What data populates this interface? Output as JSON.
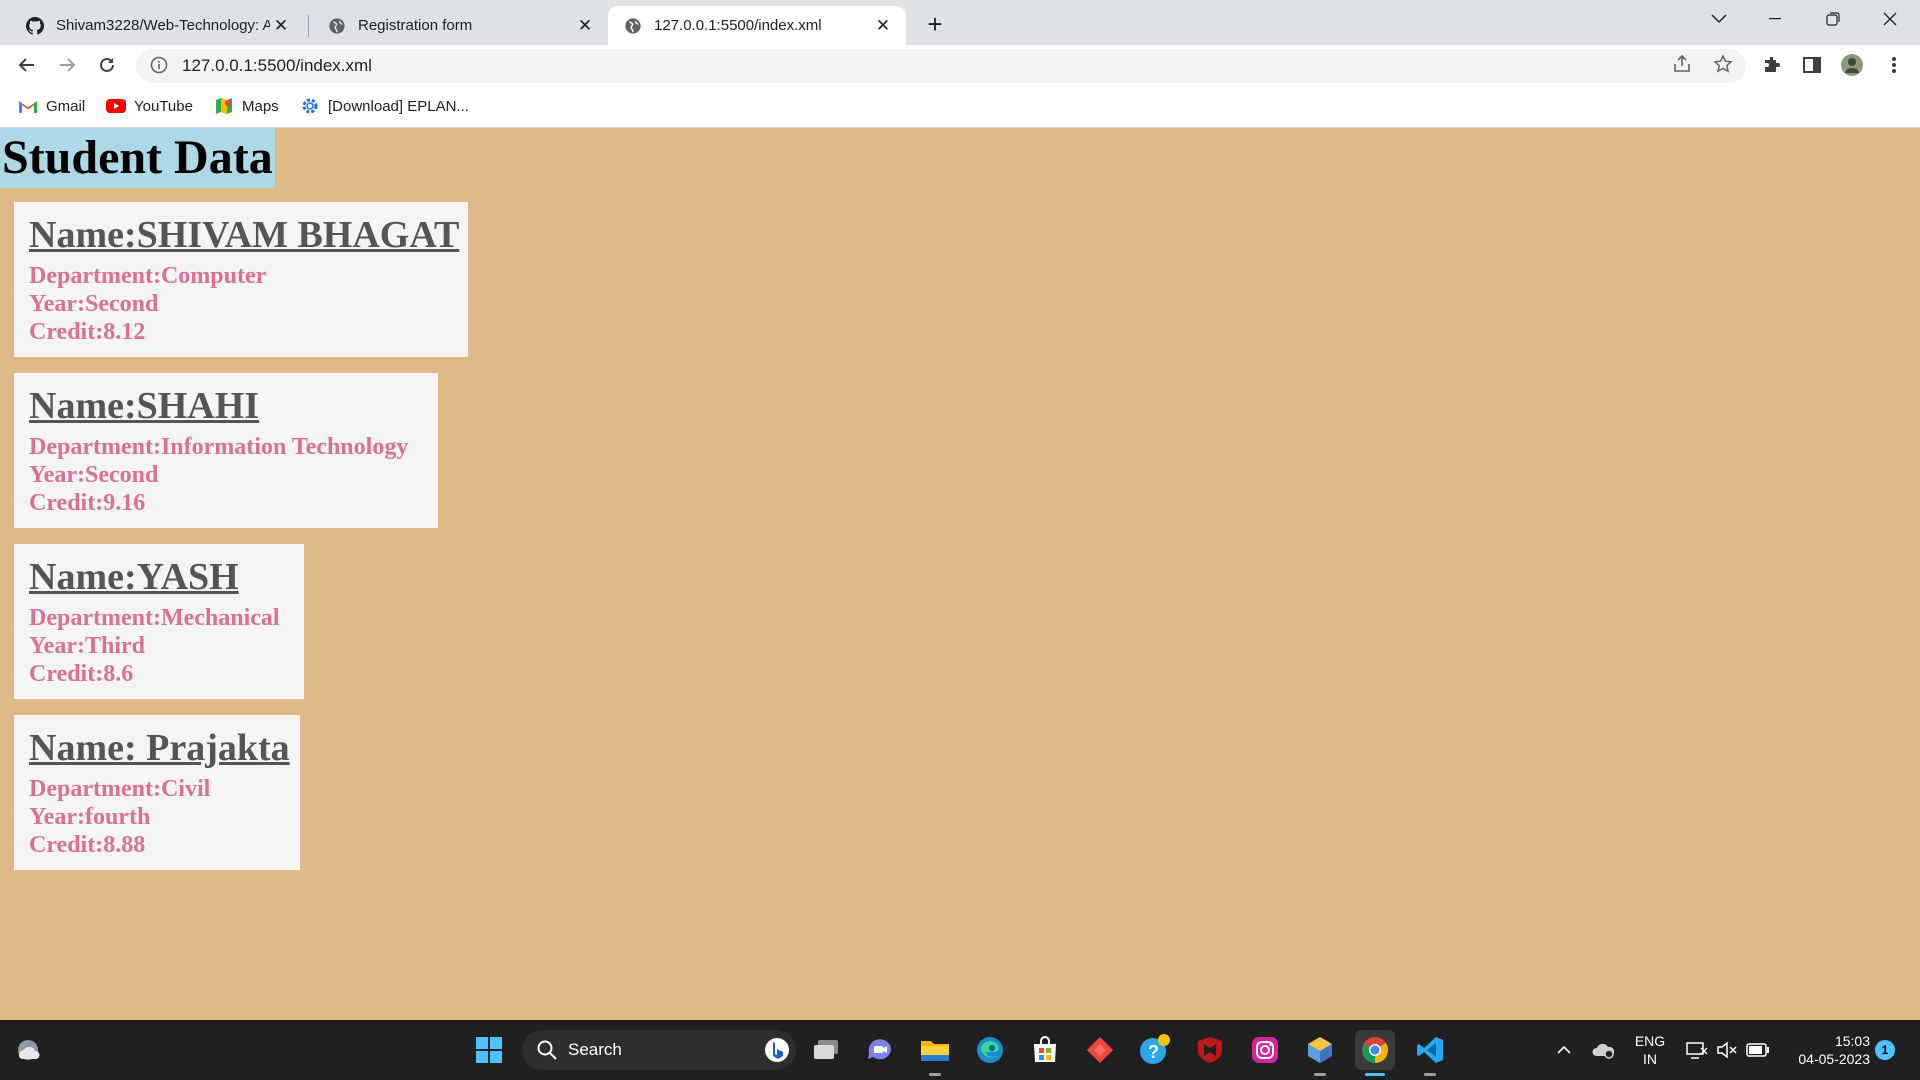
{
  "browser": {
    "tabs": [
      {
        "title": "Shivam3228/Web-Technology: A",
        "icon": "github-icon",
        "active": false
      },
      {
        "title": "Registration form",
        "icon": "globe-icon",
        "active": false
      },
      {
        "title": "127.0.0.1:5500/index.xml",
        "icon": "globe-icon",
        "active": true
      }
    ],
    "url": "127.0.0.1:5500/index.xml",
    "bookmarks": [
      {
        "label": "Gmail",
        "icon": "gmail-icon"
      },
      {
        "label": "YouTube",
        "icon": "youtube-icon"
      },
      {
        "label": "Maps",
        "icon": "maps-icon"
      },
      {
        "label": "[Download] EPLAN...",
        "icon": "gear-icon"
      }
    ]
  },
  "page": {
    "title": "Student Data",
    "background": "#DEB887",
    "title_background": "#ADD8E6",
    "name_color": "#555555",
    "detail_color": "#DB7093",
    "students": [
      {
        "name": "Name:SHIVAM BHAGAT",
        "department": "Department:Computer",
        "year": "Year:Second",
        "credit": "Credit:8.12"
      },
      {
        "name": "Name:SHAHI",
        "department": "Department:Information Technology",
        "year": "Year:Second",
        "credit": "Credit:9.16"
      },
      {
        "name": "Name:YASH",
        "department": "Department:Mechanical",
        "year": "Year:Third",
        "credit": "Credit:8.6"
      },
      {
        "name": "Name: Prajakta",
        "department": "Department:Civil",
        "year": "Year:fourth",
        "credit": "Credit:8.88"
      }
    ]
  },
  "taskbar": {
    "search_label": "Search",
    "language": {
      "line1": "ENG",
      "line2": "IN"
    },
    "time": "15:03",
    "date": "04-05-2023",
    "notification_count": "1"
  }
}
